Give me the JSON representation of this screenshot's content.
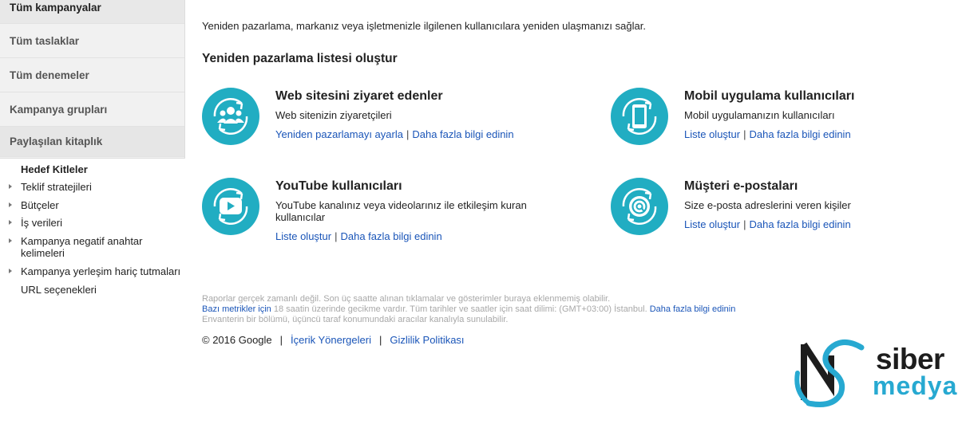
{
  "sidebar": {
    "nav": [
      {
        "label": "Tüm kampanyalar"
      },
      {
        "label": "Tüm taslaklar"
      },
      {
        "label": "Tüm denemeler"
      },
      {
        "label": "Kampanya grupları"
      },
      {
        "label": "Paylaşılan kitaplık"
      }
    ],
    "tree": [
      {
        "label": "Hedef Kitleler",
        "expandable": false,
        "active": true
      },
      {
        "label": "Teklif stratejileri",
        "expandable": true
      },
      {
        "label": "Bütçeler",
        "expandable": true
      },
      {
        "label": "İş verileri",
        "expandable": true
      },
      {
        "label": "Kampanya negatif anahtar kelimeleri",
        "expandable": true
      },
      {
        "label": "Kampanya yerleşim hariç tutmaları",
        "expandable": true
      },
      {
        "label": "URL seçenekleri",
        "expandable": false
      }
    ]
  },
  "main": {
    "intro": "Yeniden pazarlama, markanız veya işletmenizle ilgilenen kullanıcılara yeniden ulaşmanızı sağlar.",
    "heading": "Yeniden pazarlama listesi oluştur",
    "cards": [
      {
        "title": "Web sitesini ziyaret edenler",
        "desc": "Web sitenizin ziyaretçileri",
        "link1": "Yeniden pazarlamayı ayarla",
        "separator": "|",
        "link2": "Daha fazla bilgi edinin",
        "icon": "website-visitors-icon"
      },
      {
        "title": "Mobil uygulama kullanıcıları",
        "desc": "Mobil uygulamanızın kullanıcıları",
        "link1": "Liste oluştur",
        "separator": "|",
        "link2": "Daha fazla bilgi edinin",
        "icon": "mobile-app-icon"
      },
      {
        "title": "YouTube kullanıcıları",
        "desc": "YouTube kanalınız veya videolarınız ile etkileşim kuran kullanıcılar",
        "link1": "Liste oluştur",
        "separator": "|",
        "link2": "Daha fazla bilgi edinin",
        "icon": "youtube-play-icon"
      },
      {
        "title": "Müşteri e-postaları",
        "desc": "Size e-posta adreslerini veren kişiler",
        "link1": "Liste oluştur",
        "separator": "|",
        "link2": "Daha fazla bilgi edinin",
        "icon": "email-at-icon"
      }
    ],
    "notes": {
      "line1": "Raporlar gerçek zamanlı değil. Son üç saatte alınan tıklamalar ve gösterimler buraya eklenmemiş olabilir.",
      "line2_link": "Bazı metrikler için",
      "line2_text": " 18 saatin üzerinde gecikme vardır. Tüm tarihler ve saatler için saat dilimi: (GMT+03:00) İstanbul. ",
      "line2_link2": "Daha fazla bilgi edinin",
      "line3": "Envanterin bir bölümü, üçüncü taraf konumundaki aracılar kanalıyla sunulabilir."
    },
    "footer": {
      "copyright": "© 2016 Google",
      "separator": "|",
      "link1": "İçerik Yönergeleri",
      "link2": "Gizlilik Politikası"
    }
  },
  "watermark": {
    "word1": "siber",
    "word2": "medya",
    "brand_dark": "#1d1d1d",
    "brand_blue": "#27a9d1"
  },
  "colors": {
    "accent_circle": "#21adc2",
    "link": "#1a55b8"
  }
}
